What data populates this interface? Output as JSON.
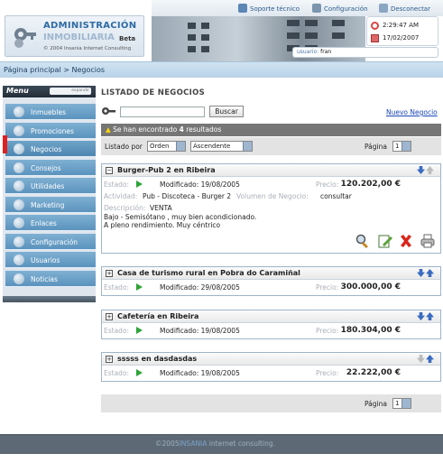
{
  "header": {
    "logo_line1": "ADMINISTRACIÓN",
    "logo_line2": "INMOBILIARIA",
    "logo_beta": "Beta",
    "logo_copyright": "© 2004 Insania Internet Consulting",
    "links": [
      "Soporte técnico",
      "Configuración",
      "Desconectar"
    ],
    "time": "2:29:47 AM",
    "date": "17/02/2007",
    "user_label": "usuario:",
    "user_name": "fran"
  },
  "breadcrumb": "Página principal > Negocios",
  "sidebar": {
    "title": "Menu",
    "control_text": "expandir",
    "items": [
      {
        "label": "Inmuebles",
        "icon": "house-icon"
      },
      {
        "label": "Promociones",
        "icon": "promo-icon"
      },
      {
        "label": "Negocios",
        "icon": "business-icon",
        "active": true
      },
      {
        "label": "Consejos",
        "icon": "advice-icon"
      },
      {
        "label": "Utilidades",
        "icon": "tools-icon"
      },
      {
        "label": "Marketing",
        "icon": "marketing-icon"
      },
      {
        "label": "Enlaces",
        "icon": "link-icon"
      },
      {
        "label": "Configuración",
        "icon": "config-icon"
      },
      {
        "label": "Usuarios",
        "icon": "users-icon"
      },
      {
        "label": "Noticias",
        "icon": "news-icon"
      }
    ]
  },
  "main": {
    "heading": "LISTADO DE NEGOCIOS",
    "search_value": "",
    "search_button": "Buscar",
    "new_link": "Nuevo Negocio",
    "results_prefix": "Se han encontrado",
    "results_count": "4",
    "results_suffix": "resultados",
    "order_label": "Listado por",
    "order_field": "Orden",
    "order_dir": "Ascendente",
    "page_label": "Página",
    "page_value": "1"
  },
  "listings": [
    {
      "title": "Burger-Pub 2 en Ribeira",
      "estado_label": "Estado:",
      "modified": "Modificado: 19/08/2005",
      "price_label": "Precio:",
      "price": "120.202,00 €",
      "activity_label": "Actividad:",
      "activity": "Pub - Discoteca - Burger 2",
      "volume_label": "Volumen de Negocio:",
      "volume": "consultar",
      "desc_label": "Descripción:",
      "desc_type": "VENTA",
      "desc_line1": "Bajo - Semisótano , muy bien acondicionado.",
      "desc_line2": "A pleno rendimiento. Muy céntrico"
    },
    {
      "title": "Casa de turismo rural en Pobra do Caramiñal",
      "estado_label": "Estado:",
      "modified": "Modificado: 29/08/2005",
      "price_label": "Precio:",
      "price": "300.000,00 €"
    },
    {
      "title": "Cafetería en Ribeira",
      "estado_label": "Estado:",
      "modified": "Modificado: 19/08/2005",
      "price_label": "Precio:",
      "price": "180.304,00 €"
    },
    {
      "title": "sssss en dasdasdas",
      "estado_label": "Estado:",
      "modified": "Modificado: 19/08/2005",
      "price_label": "Precio:",
      "price": "22.222,00 €"
    }
  ],
  "footer": {
    "prefix": "©2005",
    "brand": "INSANIA",
    "suffix": "internet consulting."
  },
  "colors": {
    "menu_item": "#6aa1c9",
    "active_marker": "#e02020",
    "results_bar": "#767676",
    "link": "#1a46b8",
    "play": "#2ea339"
  }
}
